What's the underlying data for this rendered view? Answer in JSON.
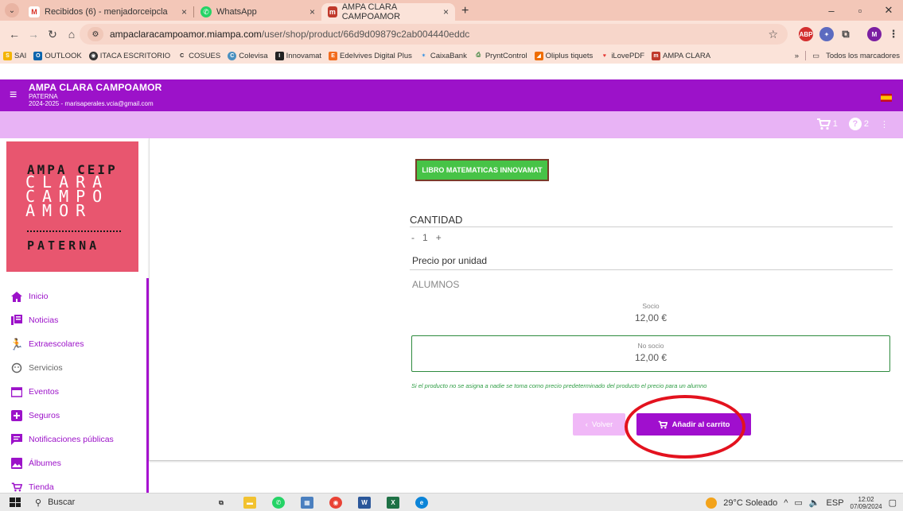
{
  "browser": {
    "tabs": [
      {
        "title": "Recibidos (6) - menjadorceipcla",
        "icon": "gmail-icon",
        "active": false
      },
      {
        "title": "WhatsApp",
        "icon": "whatsapp-icon",
        "active": false
      },
      {
        "title": "AMPA CLARA CAMPOAMOR",
        "icon": "miampa-icon",
        "active": true
      }
    ],
    "url_host": "ampaclaracampoamor.miampa.com",
    "url_path": "/user/shop/product/66d9d09879c2ab004440eddc",
    "bookmarks": [
      "SAI",
      "OUTLOOK",
      "ITACA ESCRITORIO",
      "COSUES",
      "Colevisa",
      "Innovamat",
      "Edelvives Digital Plus",
      "CaixaBank",
      "PryntControl",
      "Oliplus tiquets",
      "iLovePDF",
      "AMPA CLARA"
    ],
    "all_bookmarks": "Todos los marcadores",
    "profile_initial": "M",
    "colors": {
      "tabstrip": "#f3c7b8",
      "toolbar": "#fbe3d9"
    }
  },
  "app": {
    "name": "AMPA CLARA CAMPOAMOR",
    "city": "PATERNA",
    "year_email": "2024-2025 - marisaperales.vcia@gmail.com",
    "cart_count": "1",
    "help_count": "2",
    "colors": {
      "primary": "#9c12c9",
      "light": "#e8b3f5",
      "logo_bg": "#e8566f"
    }
  },
  "logo": {
    "line1": "AMPA CEIP",
    "line2": "CLARA",
    "line3": "CAMPO",
    "line4": "AMOR",
    "line5": "PATERNA"
  },
  "menu": [
    {
      "label": "Inicio",
      "icon": "home-icon"
    },
    {
      "label": "Noticias",
      "icon": "news-icon"
    },
    {
      "label": "Extraescolares",
      "icon": "running-icon"
    },
    {
      "label": "Servicios",
      "icon": "services-icon"
    },
    {
      "label": "Eventos",
      "icon": "calendar-icon"
    },
    {
      "label": "Seguros",
      "icon": "plus-box-icon"
    },
    {
      "label": "Notificaciones públicas",
      "icon": "message-icon"
    },
    {
      "label": "Álbumes",
      "icon": "image-icon"
    },
    {
      "label": "Tienda",
      "icon": "cart-icon"
    }
  ],
  "product": {
    "name": "LIBRO MATEMATICAS INNOVAMAT",
    "quantity_label": "CANTIDAD",
    "quantity": "1",
    "minus": "-",
    "plus": "+",
    "unit_price_label": "Precio por unidad",
    "group": "ALUMNOS",
    "socio_label": "Socio",
    "socio_price": "12,00 €",
    "nosocio_label": "No socio",
    "nosocio_price": "12,00 €",
    "note": "Si el producto no se asigna a nadie se toma como precio predeterminado del producto el precio para un alumno",
    "back_label": "Volver",
    "add_label": "Añadir al carrito"
  },
  "taskbar": {
    "search": "Buscar",
    "weather": "29°C Soleado",
    "lang": "ESP",
    "time": "12:02",
    "date": "07/09/2024"
  }
}
